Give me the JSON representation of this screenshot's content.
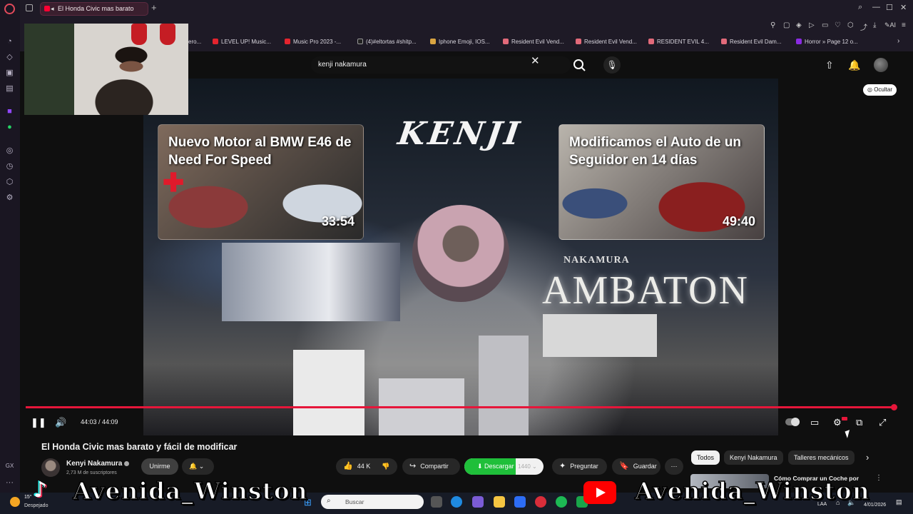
{
  "browser": {
    "tab_title": "El Honda Civic mas barato",
    "new_tab_symbol": "+",
    "bookmarks": [
      "ero...",
      "LEVEL UP! Music...",
      "Music Pro 2023 -...",
      "(4)#eltortas #shitp...",
      "Iphone Emoji, IOS...",
      "Resident Evil Vend...",
      "Resident Evil Vend...",
      "RESIDENT EVIL 4...",
      "Resident Evil Dam...",
      "Horror » Page 12 o..."
    ],
    "ai_label": "AI",
    "accent_color": "#e34a5b"
  },
  "youtube": {
    "search_query": "kenji nakamura",
    "hide_label": "Ocultar",
    "video": {
      "logo_text": "KENJI",
      "title_overlay_small": "NAKAMURA",
      "title_overlay_large": "AMBATON",
      "endcards": [
        {
          "title": "Nuevo Motor al BMW E46 de Need For Speed",
          "duration": "33:54"
        },
        {
          "title": "Modificamos el Auto de un Seguidor en 14 días",
          "duration": "49:40"
        }
      ],
      "time": "44:03 / 44:09",
      "progress": 0.9977,
      "progress_color": "#e6163a"
    },
    "title": "El Honda Civic mas barato y fácil de modificar",
    "channel": {
      "name": "Kenyi Nakamura",
      "subscribers": "2,73 M de suscriptores",
      "join_label": "Unirme"
    },
    "actions": {
      "likes": "44 K",
      "share": "Compartir",
      "download": "Descargar",
      "quality": "1440",
      "ask": "Preguntar",
      "save": "Guardar"
    },
    "chips": [
      "Todos",
      "Kenyi Nakamura",
      "Talleres mecánicos"
    ],
    "recommended_title": "Cómo Comprar un Coche por"
  },
  "overlay": {
    "watermark": "Avenida_Winston"
  },
  "taskbar": {
    "temperature": "15°",
    "weather": "Despejado",
    "search_placeholder": "Buscar",
    "language": "LAA",
    "date": "4/01/2026"
  }
}
